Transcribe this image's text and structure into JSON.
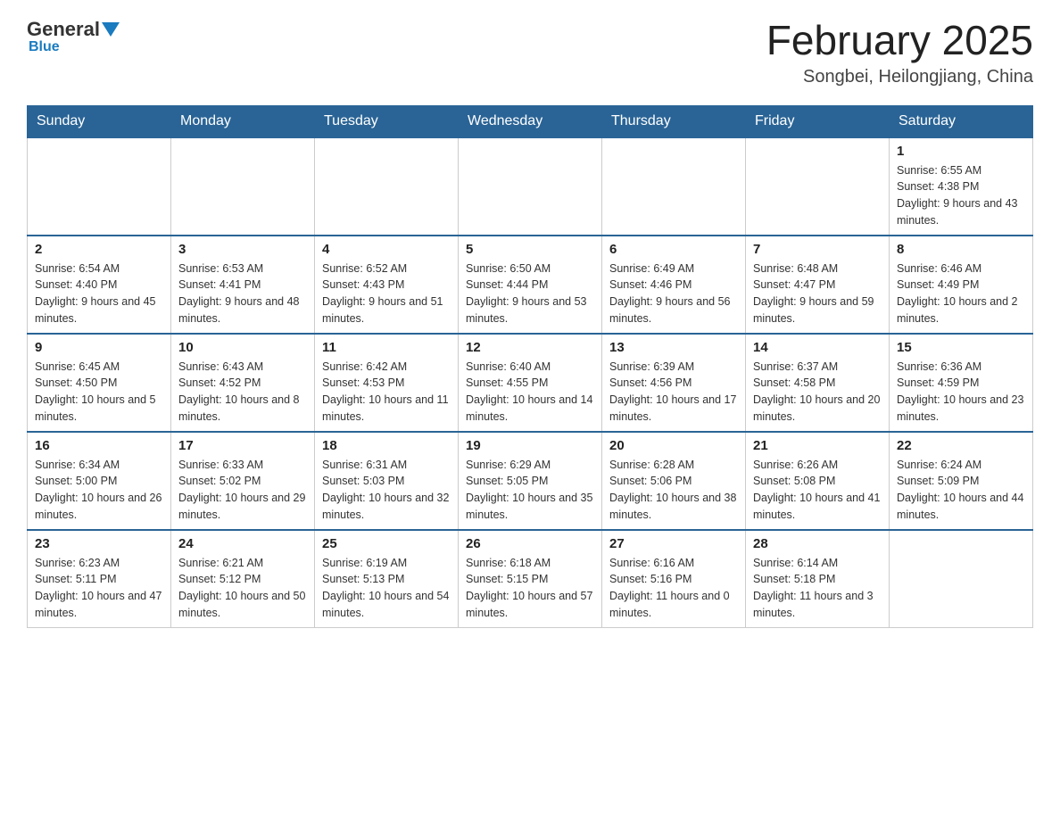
{
  "header": {
    "logo": {
      "general": "General",
      "blue": "Blue"
    },
    "title": "February 2025",
    "location": "Songbei, Heilongjiang, China"
  },
  "days_of_week": [
    "Sunday",
    "Monday",
    "Tuesday",
    "Wednesday",
    "Thursday",
    "Friday",
    "Saturday"
  ],
  "weeks": [
    {
      "days": [
        {
          "number": "",
          "info": ""
        },
        {
          "number": "",
          "info": ""
        },
        {
          "number": "",
          "info": ""
        },
        {
          "number": "",
          "info": ""
        },
        {
          "number": "",
          "info": ""
        },
        {
          "number": "",
          "info": ""
        },
        {
          "number": "1",
          "info": "Sunrise: 6:55 AM\nSunset: 4:38 PM\nDaylight: 9 hours and 43 minutes."
        }
      ]
    },
    {
      "days": [
        {
          "number": "2",
          "info": "Sunrise: 6:54 AM\nSunset: 4:40 PM\nDaylight: 9 hours and 45 minutes."
        },
        {
          "number": "3",
          "info": "Sunrise: 6:53 AM\nSunset: 4:41 PM\nDaylight: 9 hours and 48 minutes."
        },
        {
          "number": "4",
          "info": "Sunrise: 6:52 AM\nSunset: 4:43 PM\nDaylight: 9 hours and 51 minutes."
        },
        {
          "number": "5",
          "info": "Sunrise: 6:50 AM\nSunset: 4:44 PM\nDaylight: 9 hours and 53 minutes."
        },
        {
          "number": "6",
          "info": "Sunrise: 6:49 AM\nSunset: 4:46 PM\nDaylight: 9 hours and 56 minutes."
        },
        {
          "number": "7",
          "info": "Sunrise: 6:48 AM\nSunset: 4:47 PM\nDaylight: 9 hours and 59 minutes."
        },
        {
          "number": "8",
          "info": "Sunrise: 6:46 AM\nSunset: 4:49 PM\nDaylight: 10 hours and 2 minutes."
        }
      ]
    },
    {
      "days": [
        {
          "number": "9",
          "info": "Sunrise: 6:45 AM\nSunset: 4:50 PM\nDaylight: 10 hours and 5 minutes."
        },
        {
          "number": "10",
          "info": "Sunrise: 6:43 AM\nSunset: 4:52 PM\nDaylight: 10 hours and 8 minutes."
        },
        {
          "number": "11",
          "info": "Sunrise: 6:42 AM\nSunset: 4:53 PM\nDaylight: 10 hours and 11 minutes."
        },
        {
          "number": "12",
          "info": "Sunrise: 6:40 AM\nSunset: 4:55 PM\nDaylight: 10 hours and 14 minutes."
        },
        {
          "number": "13",
          "info": "Sunrise: 6:39 AM\nSunset: 4:56 PM\nDaylight: 10 hours and 17 minutes."
        },
        {
          "number": "14",
          "info": "Sunrise: 6:37 AM\nSunset: 4:58 PM\nDaylight: 10 hours and 20 minutes."
        },
        {
          "number": "15",
          "info": "Sunrise: 6:36 AM\nSunset: 4:59 PM\nDaylight: 10 hours and 23 minutes."
        }
      ]
    },
    {
      "days": [
        {
          "number": "16",
          "info": "Sunrise: 6:34 AM\nSunset: 5:00 PM\nDaylight: 10 hours and 26 minutes."
        },
        {
          "number": "17",
          "info": "Sunrise: 6:33 AM\nSunset: 5:02 PM\nDaylight: 10 hours and 29 minutes."
        },
        {
          "number": "18",
          "info": "Sunrise: 6:31 AM\nSunset: 5:03 PM\nDaylight: 10 hours and 32 minutes."
        },
        {
          "number": "19",
          "info": "Sunrise: 6:29 AM\nSunset: 5:05 PM\nDaylight: 10 hours and 35 minutes."
        },
        {
          "number": "20",
          "info": "Sunrise: 6:28 AM\nSunset: 5:06 PM\nDaylight: 10 hours and 38 minutes."
        },
        {
          "number": "21",
          "info": "Sunrise: 6:26 AM\nSunset: 5:08 PM\nDaylight: 10 hours and 41 minutes."
        },
        {
          "number": "22",
          "info": "Sunrise: 6:24 AM\nSunset: 5:09 PM\nDaylight: 10 hours and 44 minutes."
        }
      ]
    },
    {
      "days": [
        {
          "number": "23",
          "info": "Sunrise: 6:23 AM\nSunset: 5:11 PM\nDaylight: 10 hours and 47 minutes."
        },
        {
          "number": "24",
          "info": "Sunrise: 6:21 AM\nSunset: 5:12 PM\nDaylight: 10 hours and 50 minutes."
        },
        {
          "number": "25",
          "info": "Sunrise: 6:19 AM\nSunset: 5:13 PM\nDaylight: 10 hours and 54 minutes."
        },
        {
          "number": "26",
          "info": "Sunrise: 6:18 AM\nSunset: 5:15 PM\nDaylight: 10 hours and 57 minutes."
        },
        {
          "number": "27",
          "info": "Sunrise: 6:16 AM\nSunset: 5:16 PM\nDaylight: 11 hours and 0 minutes."
        },
        {
          "number": "28",
          "info": "Sunrise: 6:14 AM\nSunset: 5:18 PM\nDaylight: 11 hours and 3 minutes."
        },
        {
          "number": "",
          "info": ""
        }
      ]
    }
  ]
}
